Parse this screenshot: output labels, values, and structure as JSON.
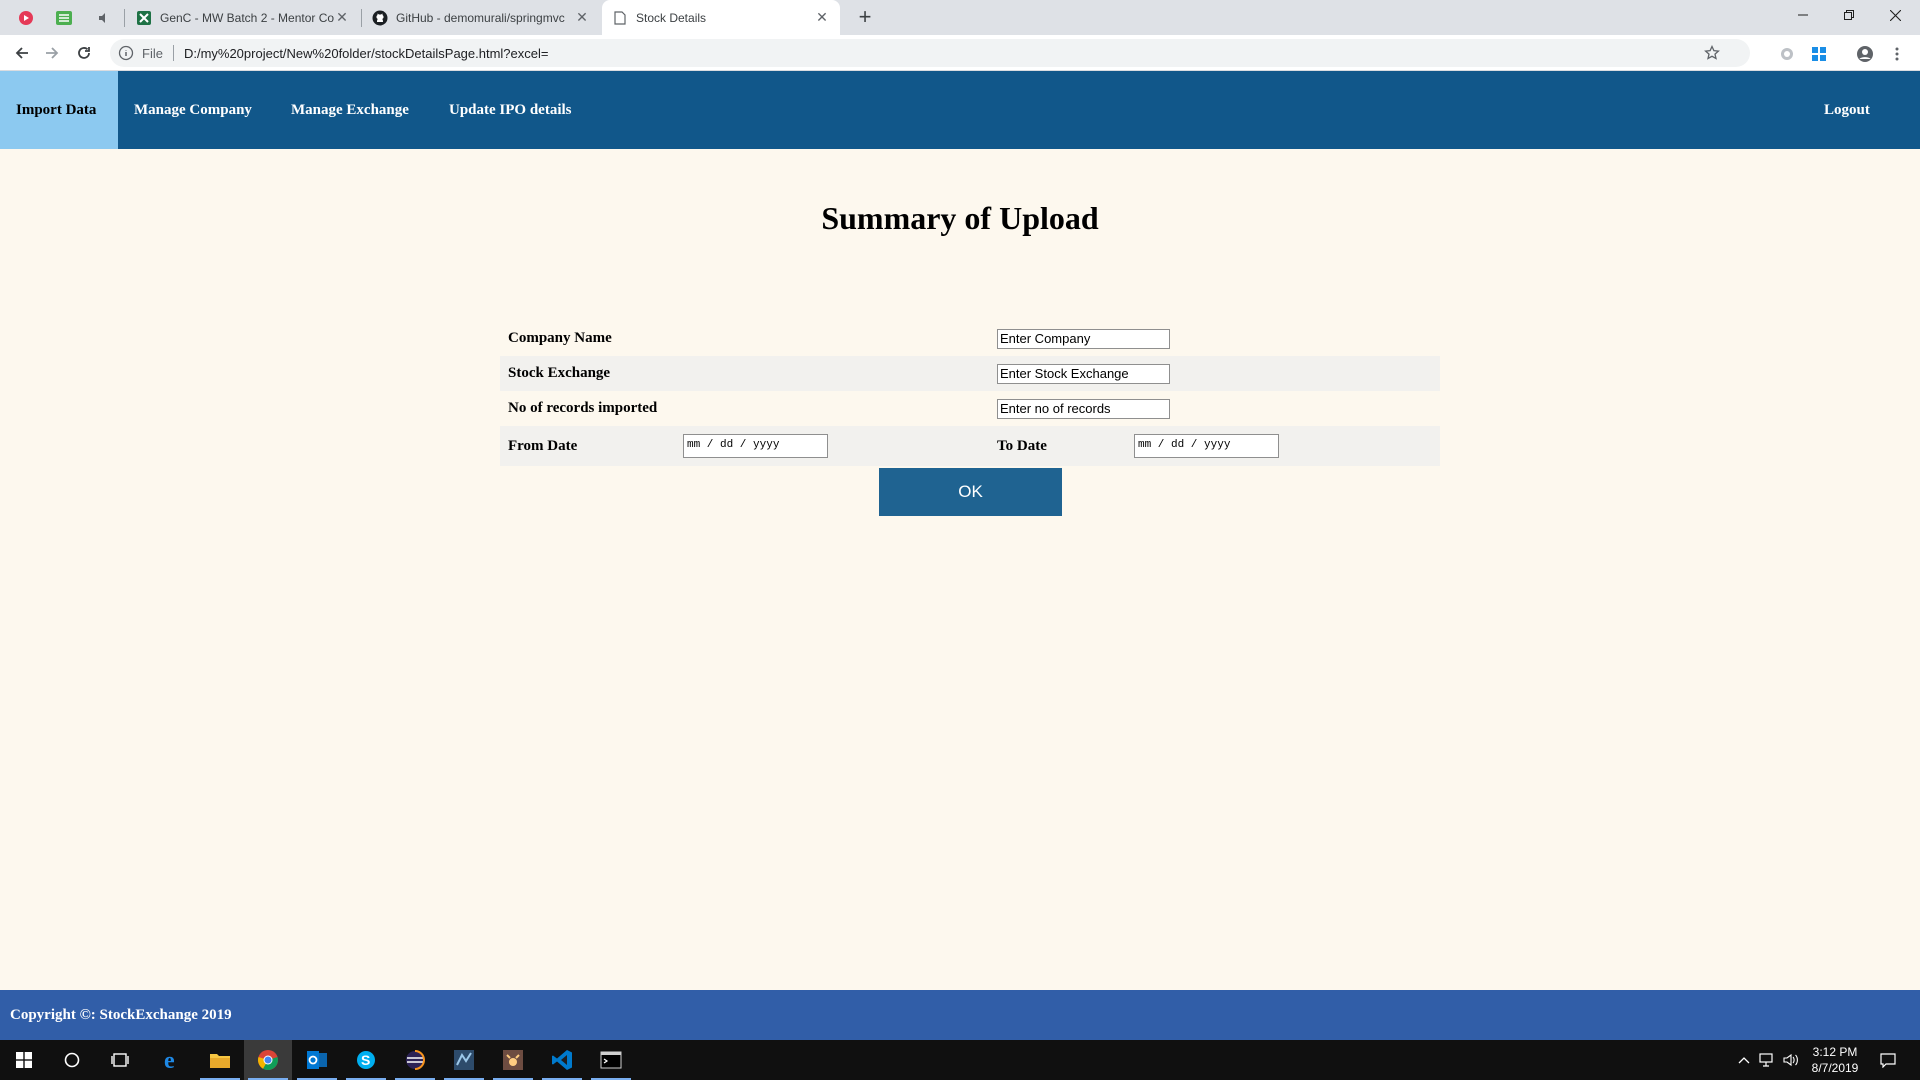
{
  "browser": {
    "tabs": [
      {
        "title": "GenC - MW Batch 2 - Mentor Co",
        "icon": "sheets-icon"
      },
      {
        "title": "GitHub - demomurali/springmvc",
        "icon": "github-icon"
      },
      {
        "title": "Stock Details",
        "icon": "page-icon"
      }
    ],
    "url_scheme": "File",
    "url": "D:/my%20project/New%20folder/stockDetailsPage.html?excel=",
    "close_glyph": "✕",
    "new_tab_glyph": "+"
  },
  "nav": {
    "links": [
      {
        "label": "Import Data"
      },
      {
        "label": "Manage Company"
      },
      {
        "label": "Manage Exchange"
      },
      {
        "label": "Update IPO details"
      }
    ],
    "logout": "Logout"
  },
  "page": {
    "title": "Summary of Upload",
    "fields": {
      "company": {
        "label": "Company Name",
        "placeholder": "Enter Company"
      },
      "exchange": {
        "label": "Stock Exchange",
        "placeholder": "Enter Stock Exchange"
      },
      "records": {
        "label": "No of records imported",
        "placeholder": "Enter no of records"
      },
      "from_date": {
        "label": "From Date",
        "placeholder": "mm / dd / yyyy"
      },
      "to_date": {
        "label": "To Date",
        "placeholder": "mm / dd / yyyy"
      }
    },
    "ok_button": "OK"
  },
  "footer": {
    "text": "Copyright ©: StockExchange 2019"
  },
  "taskbar": {
    "time": "3:12 PM",
    "date": "8/7/2019",
    "apps": [
      "start-icon",
      "search-icon",
      "task-view-icon",
      "edge-icon",
      "file-explorer-icon",
      "chrome-icon",
      "outlook-icon",
      "skype-icon",
      "eclipse-icon",
      "mysql-workbench-icon",
      "tomcat-icon",
      "vscode-icon",
      "terminal-icon"
    ]
  },
  "colors": {
    "nav_bg": "#11578a",
    "nav_active": "#8cc9f0",
    "page_bg": "#fdf8ee",
    "ok_button": "#1f6391",
    "footer": "#315ea8"
  }
}
